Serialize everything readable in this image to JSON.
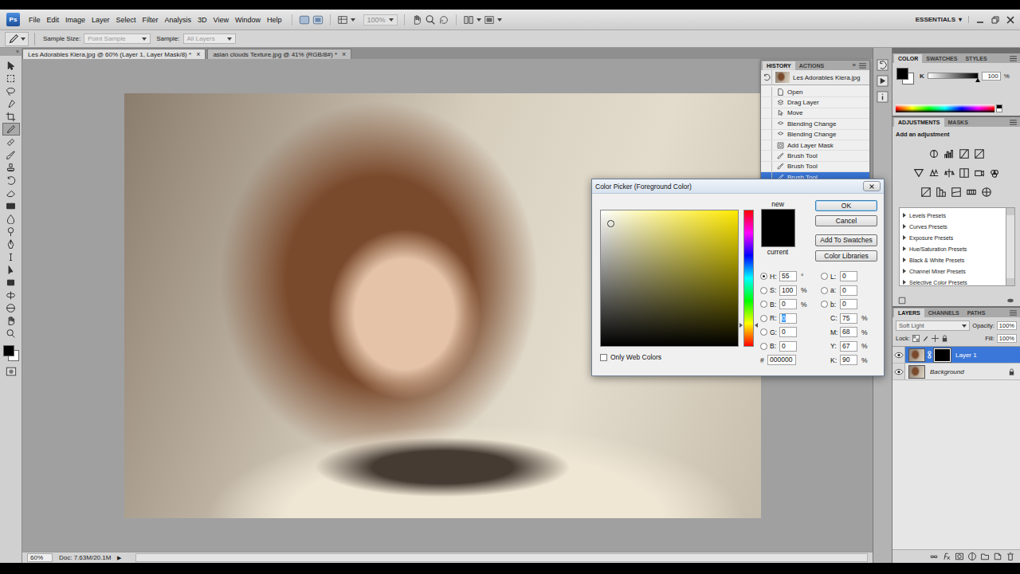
{
  "app": {
    "logo": "Ps",
    "menus": [
      "File",
      "Edit",
      "Image",
      "Layer",
      "Select",
      "Filter",
      "Analysis",
      "3D",
      "View",
      "Window",
      "Help"
    ],
    "zoom": {
      "value": "100%",
      "disabled": true
    },
    "workspace": "ESSENTIALS",
    "workspace_arrow": "▾"
  },
  "options_bar": {
    "fields": [
      {
        "label": "Sample Size:",
        "value": "Point Sample",
        "disabled": true
      },
      {
        "label": "Sample:",
        "value": "All Layers",
        "disabled": true
      }
    ]
  },
  "toolbar": {
    "collapse": "»",
    "tools": [
      {
        "selected": false
      },
      {
        "selected": false
      },
      {
        "selected": false
      },
      {
        "selected": false
      },
      {
        "selected": false
      },
      {
        "selected": true
      },
      {
        "selected": false
      },
      {
        "selected": false
      },
      {
        "selected": false
      },
      {
        "selected": false
      },
      {
        "selected": false
      },
      {
        "selected": false
      },
      {
        "selected": false
      },
      {
        "selected": false
      },
      {
        "selected": false
      },
      {
        "selected": false
      },
      {
        "selected": false
      },
      {
        "selected": false
      },
      {
        "selected": false
      },
      {
        "selected": false
      },
      {
        "selected": false
      },
      {
        "selected": false
      }
    ]
  },
  "document_tabs": [
    {
      "label": "Les Adorables Kiera.jpg @ 60% (Layer 1, Layer Mask/8) *",
      "selected": true,
      "close": "×"
    },
    {
      "label": "asian clouds Texture.jpg @ 41% (RGB/8#) *",
      "selected": false,
      "close": "×"
    }
  ],
  "status_bar": {
    "zoom": "60%",
    "doc": "Doc: 7.63M/20.1M",
    "arrow": "▶"
  },
  "history": {
    "tabs": [
      {
        "label": "HISTORY",
        "selected": true
      },
      {
        "label": "ACTIONS",
        "selected": false
      }
    ],
    "collapse": "»",
    "snapshot": {
      "label": "Les Adorables Kiera.jpg",
      "source": true
    },
    "items": [
      {
        "label": "Open",
        "kind": "open",
        "selected": false
      },
      {
        "label": "Drag Layer",
        "kind": "layer",
        "selected": false
      },
      {
        "label": "Move",
        "kind": "move",
        "selected": false
      },
      {
        "label": "Blending Change",
        "kind": "blend",
        "selected": false
      },
      {
        "label": "Blending Change",
        "kind": "blend",
        "selected": false
      },
      {
        "label": "Add Layer Mask",
        "kind": "mask",
        "selected": false
      },
      {
        "label": "Brush Tool",
        "kind": "brush",
        "selected": false
      },
      {
        "label": "Brush Tool",
        "kind": "brush",
        "selected": false
      },
      {
        "label": "Brush Tool",
        "kind": "brush",
        "selected": true
      }
    ]
  },
  "color_panel": {
    "tabs": [
      {
        "label": "COLOR",
        "selected": true
      },
      {
        "label": "SWATCHES",
        "selected": false
      },
      {
        "label": "STYLES",
        "selected": false
      }
    ],
    "channel": "K",
    "level": 1,
    "value": "100",
    "unit": "%"
  },
  "adjustments": {
    "tabs": [
      {
        "label": "ADJUSTMENTS",
        "selected": true
      },
      {
        "label": "MASKS",
        "selected": false
      }
    ],
    "heading": "Add an adjustment",
    "presets": [
      {
        "label": "Levels Presets",
        "expanded": false
      },
      {
        "label": "Curves Presets",
        "expanded": false
      },
      {
        "label": "Exposure Presets",
        "expanded": false
      },
      {
        "label": "Hue/Saturation Presets",
        "expanded": false
      },
      {
        "label": "Black & White Presets",
        "expanded": false
      },
      {
        "label": "Channel Mixer Presets",
        "expanded": false
      },
      {
        "label": "Selective Color Presets",
        "expanded": false
      }
    ]
  },
  "layers": {
    "tabs": [
      {
        "label": "LAYERS",
        "selected": true
      },
      {
        "label": "CHANNELS",
        "selected": false
      },
      {
        "label": "PATHS",
        "selected": false
      }
    ],
    "blend_mode": "Soft Light",
    "opacity_label": "Opacity:",
    "opacity": "100%",
    "lock_label": "Lock:",
    "fill_label": "Fill:",
    "fill": "100%",
    "items": [
      {
        "name": "Layer 1",
        "selected": true,
        "visible": true,
        "has_mask": true,
        "locked": false
      },
      {
        "name": "Background",
        "selected": false,
        "visible": true,
        "has_mask": false,
        "locked": true
      }
    ]
  },
  "color_picker": {
    "title": "Color Picker (Foreground Color)",
    "new_label": "new",
    "current_label": "current",
    "hue_level": 0.153,
    "buttons": [
      {
        "label": "OK",
        "default": true
      },
      {
        "label": "Cancel",
        "default": false
      },
      {
        "label": "Add To Swatches",
        "default": false
      },
      {
        "label": "Color Libraries",
        "default": false
      }
    ],
    "left_fields": [
      {
        "label": "H:",
        "value": "55",
        "unit": "°",
        "radio": true,
        "selected": true,
        "focused": false
      },
      {
        "label": "S:",
        "value": "100",
        "unit": "%",
        "radio": true,
        "selected": false,
        "focused": false
      },
      {
        "label": "B:",
        "value": "0",
        "unit": "%",
        "radio": true,
        "selected": false,
        "focused": false
      },
      {
        "label": "R:",
        "value": "0",
        "radio": true,
        "selected": false,
        "focused": true
      },
      {
        "label": "G:",
        "value": "0",
        "radio": true,
        "selected": false,
        "focused": false
      },
      {
        "label": "B:",
        "value": "0",
        "radio": true,
        "selected": false,
        "focused": false
      }
    ],
    "hex": {
      "label": "#",
      "value": "000000"
    },
    "right_fields": [
      {
        "label": "L:",
        "value": "0",
        "radio": true,
        "selected": false,
        "focused": false
      },
      {
        "label": "a:",
        "value": "0",
        "radio": true,
        "selected": false,
        "focused": false
      },
      {
        "label": "b:",
        "value": "0",
        "radio": true,
        "selected": false,
        "focused": false
      },
      {
        "label": "C:",
        "value": "75",
        "unit": "%",
        "radio": false,
        "selected": false,
        "focused": false
      },
      {
        "label": "M:",
        "value": "68",
        "unit": "%",
        "radio": false,
        "selected": false,
        "focused": false
      },
      {
        "label": "Y:",
        "value": "67",
        "unit": "%",
        "radio": false,
        "selected": false,
        "focused": false
      },
      {
        "label": "K:",
        "value": "90",
        "unit": "%",
        "radio": false,
        "selected": false,
        "focused": false
      }
    ],
    "web_only": {
      "label": "Only Web Colors",
      "checked": false
    }
  }
}
